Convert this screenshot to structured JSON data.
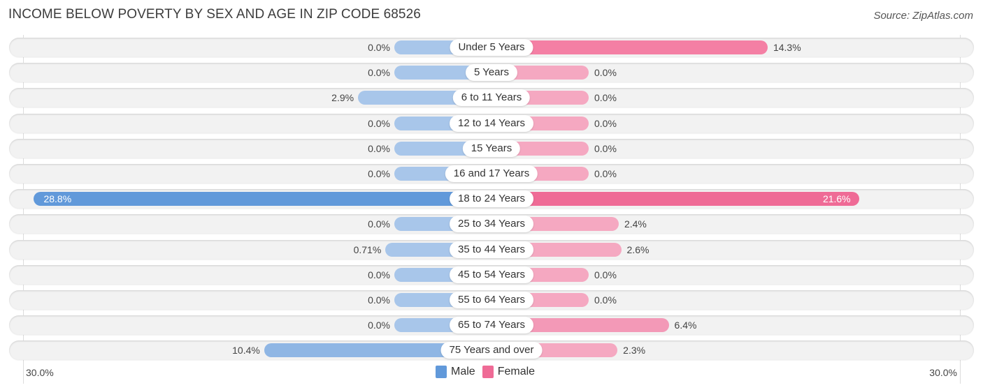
{
  "header": {
    "title": "INCOME BELOW POVERTY BY SEX AND AGE IN ZIP CODE 68526",
    "source": "Source: ZipAtlas.com"
  },
  "colors": {
    "male_strong": "#6199da",
    "male_light": "#a8c6ea",
    "female_strong": "#ef6b96",
    "female_light": "#f5a8c1",
    "row_bg": "#f2f2f2"
  },
  "chart_data": {
    "type": "bar",
    "orientation": "horizontal-diverging",
    "title": "INCOME BELOW POVERTY BY SEX AND AGE IN ZIP CODE 68526",
    "categories": [
      "Under 5 Years",
      "5 Years",
      "6 to 11 Years",
      "12 to 14 Years",
      "15 Years",
      "16 and 17 Years",
      "18 to 24 Years",
      "25 to 34 Years",
      "35 to 44 Years",
      "45 to 54 Years",
      "55 to 64 Years",
      "65 to 74 Years",
      "75 Years and over"
    ],
    "series": [
      {
        "name": "Male",
        "values": [
          0.0,
          0.0,
          2.9,
          0.0,
          0.0,
          0.0,
          28.8,
          0.0,
          0.71,
          0.0,
          0.0,
          0.0,
          10.4
        ],
        "labels": [
          "0.0%",
          "0.0%",
          "2.9%",
          "0.0%",
          "0.0%",
          "0.0%",
          "28.8%",
          "0.0%",
          "0.71%",
          "0.0%",
          "0.0%",
          "0.0%",
          "10.4%"
        ]
      },
      {
        "name": "Female",
        "values": [
          14.3,
          0.0,
          0.0,
          0.0,
          0.0,
          0.0,
          21.6,
          2.4,
          2.6,
          0.0,
          0.0,
          6.4,
          2.3
        ],
        "labels": [
          "14.3%",
          "0.0%",
          "0.0%",
          "0.0%",
          "0.0%",
          "0.0%",
          "21.6%",
          "2.4%",
          "2.6%",
          "0.0%",
          "0.0%",
          "6.4%",
          "2.3%"
        ]
      }
    ],
    "xlim": [
      -30,
      30
    ],
    "axis_left_label": "30.0%",
    "axis_right_label": "30.0%",
    "legend": {
      "position": "bottom-center",
      "entries": [
        "Male",
        "Female"
      ]
    },
    "unit": "%"
  }
}
